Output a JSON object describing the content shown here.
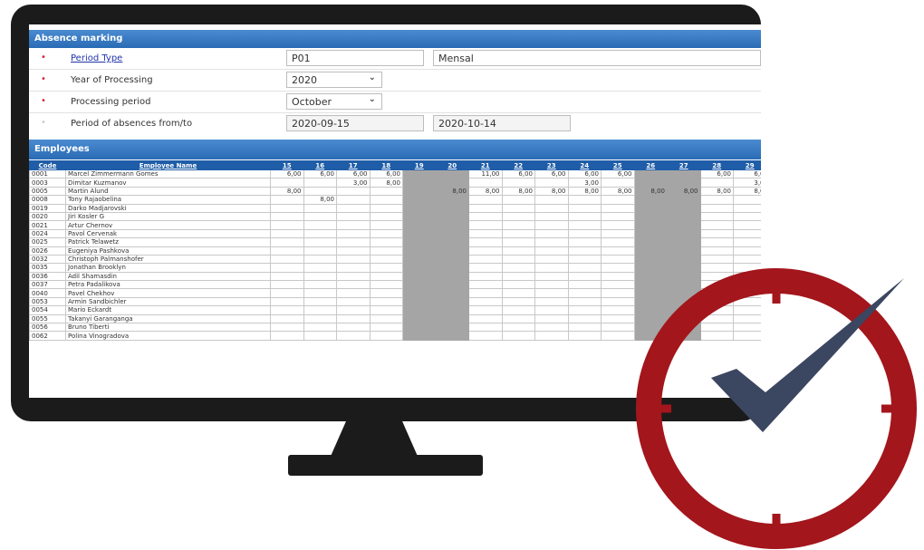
{
  "form": {
    "title": "Absence marking",
    "period_type": {
      "label": "Period Type",
      "value": "P01",
      "description": "Mensal"
    },
    "year": {
      "label": "Year of Processing",
      "value": "2020"
    },
    "period": {
      "label": "Processing period",
      "value": "October"
    },
    "range": {
      "label": "Period of absences from/to",
      "from": "2020-09-15",
      "to": "2020-10-14"
    }
  },
  "employees": {
    "title": "Employees",
    "col_code": "Code",
    "col_name": "Employee Name",
    "days": [
      "15",
      "16",
      "17",
      "18",
      "19",
      "20",
      "21",
      "22",
      "23",
      "24",
      "25",
      "26",
      "27",
      "28",
      "29"
    ],
    "weekend_days": [
      "19",
      "20",
      "26",
      "27"
    ],
    "rows": [
      {
        "code": "0001",
        "name": "Marcel Zimmermann Gomes",
        "values": [
          "6,00",
          "6,00",
          "6,00",
          "6,00",
          "",
          "",
          "11,00",
          "6,00",
          "6,00",
          "6,00",
          "6,00",
          "",
          "",
          "6,00",
          "6,0"
        ]
      },
      {
        "code": "0003",
        "name": "Dimitar Kuzmanov",
        "values": [
          "",
          "",
          "3,00",
          "8,00",
          "",
          "",
          "",
          "",
          "",
          "3,00",
          "",
          "",
          "",
          "",
          "3,0"
        ]
      },
      {
        "code": "0005",
        "name": "Martin Alund",
        "values": [
          "8,00",
          "",
          "",
          "",
          "",
          "8,00",
          "8,00",
          "8,00",
          "8,00",
          "8,00",
          "8,00",
          "8,00",
          "8,00",
          "8,00",
          "8,0"
        ]
      },
      {
        "code": "0008",
        "name": "Tony Rajaobelina",
        "values": [
          "",
          "8,00",
          "",
          "",
          "",
          "",
          "",
          "",
          "",
          "",
          "",
          "",
          "",
          "",
          ""
        ]
      },
      {
        "code": "0019",
        "name": "Darko Madjarovski",
        "values": []
      },
      {
        "code": "0020",
        "name": "Jiri Kosler G",
        "values": []
      },
      {
        "code": "0021",
        "name": "Artur Chernov",
        "values": []
      },
      {
        "code": "0024",
        "name": "Pavol Cervenak",
        "values": []
      },
      {
        "code": "0025",
        "name": "Patrick Telawetz",
        "values": []
      },
      {
        "code": "0026",
        "name": "Eugeniya Pashkova",
        "values": []
      },
      {
        "code": "0032",
        "name": "Christoph Palmanshofer",
        "values": []
      },
      {
        "code": "0035",
        "name": "Jonathan Brooklyn",
        "values": []
      },
      {
        "code": "0036",
        "name": "Adil Shamasdin",
        "values": []
      },
      {
        "code": "0037",
        "name": "Petra Padalikova",
        "values": []
      },
      {
        "code": "0040",
        "name": "Pavel Chekhov",
        "values": []
      },
      {
        "code": "0053",
        "name": "Armin Sandbichler",
        "values": []
      },
      {
        "code": "0054",
        "name": "Mario Eckardt",
        "values": []
      },
      {
        "code": "0055",
        "name": "Takanyi Garanganga",
        "values": []
      },
      {
        "code": "0056",
        "name": "Bruno Tiberti",
        "values": []
      },
      {
        "code": "0062",
        "name": "Polina Vinogradova",
        "values": []
      }
    ]
  },
  "colors": {
    "header_blue": "#2a6bb5",
    "grid_header": "#1f5da8",
    "weekend_gray": "#a5a5a5",
    "clock_red": "#a3161c",
    "check_navy": "#3b4660",
    "required_marker": "#dd2233"
  },
  "icons": {
    "required": "asterisk-icon",
    "select": "chevron-down-icon",
    "badge": "clock-check-icon"
  }
}
